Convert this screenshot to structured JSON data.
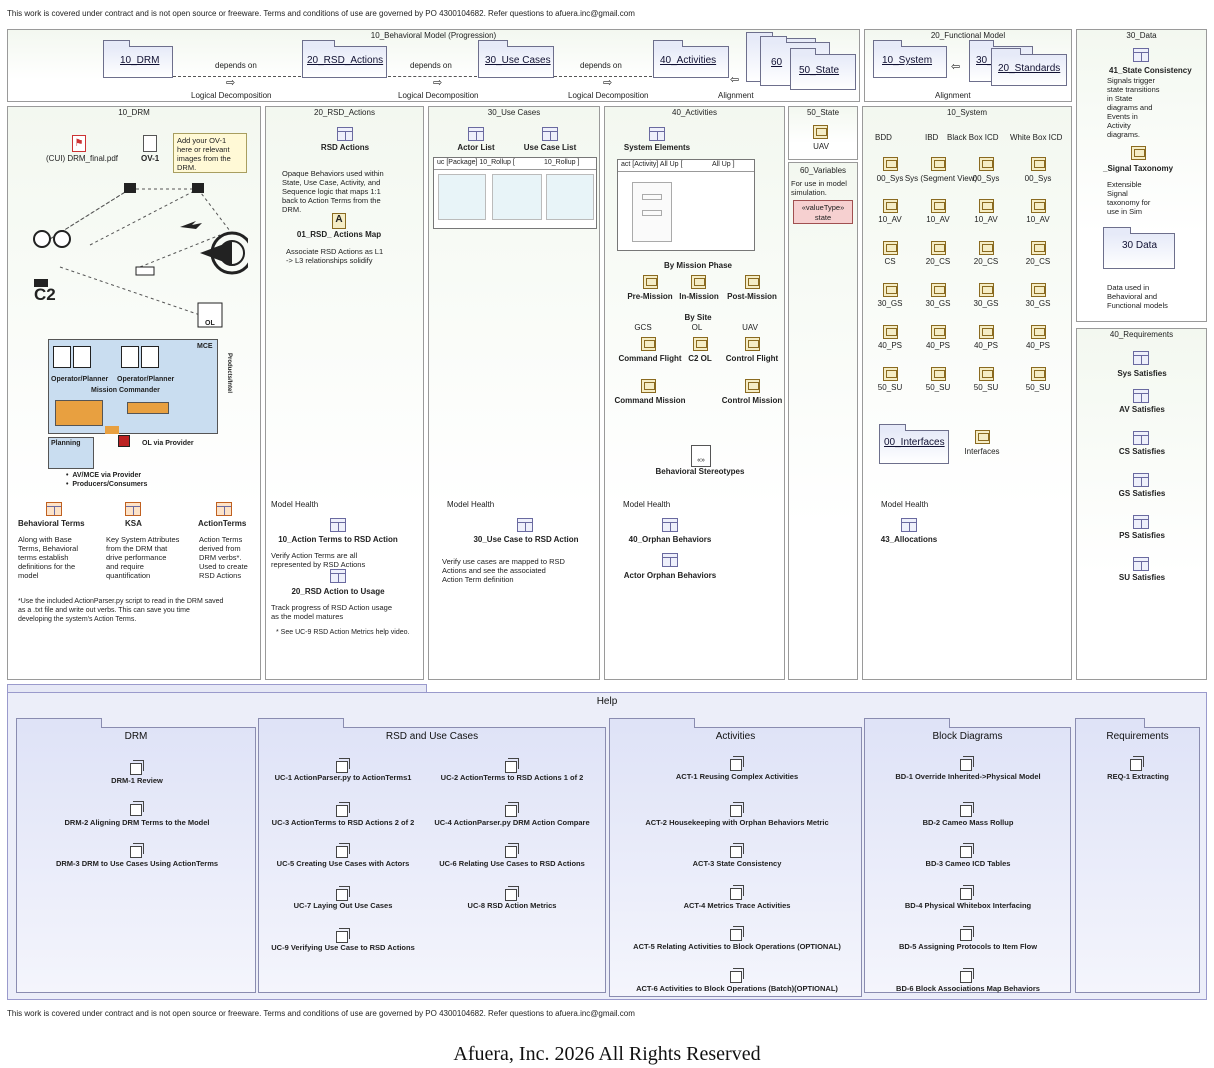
{
  "notice_top": "This work is covered under contract and is not open source or freeware.  Terms and conditions of use are governed by PO 4300104682.  Refer questions to afuera.inc@gmail.com",
  "notice_bottom": "This work is covered under contract and is not open source or freeware.  Terms and conditions of use are governed by PO 4300104682.  Refer questions to afuera.inc@gmail.com",
  "footer": "Afuera, Inc. 2026 All Rights Reserved",
  "behavioral": {
    "title": "10_Behavioral Model (Progression)",
    "packages": [
      "10_DRM",
      "20_RSD_Actions",
      "30_Use Cases",
      "40_Activities",
      "60",
      "50_State"
    ],
    "depends": [
      "depends on",
      "depends on",
      "depends on"
    ],
    "decomp": [
      "Logical Decomposition",
      "Logical Decomposition",
      "Logical Decomposition"
    ],
    "alignment": "Alignment"
  },
  "functional": {
    "title": "20_Functional Model",
    "packages": [
      "10_System",
      "30_F",
      "20_Standards"
    ],
    "alignment": "Alignment"
  },
  "data_panel": {
    "title": "30_Data",
    "state_consistency": "41_State Consistency",
    "state_desc": [
      "Signals trigger",
      "state transitions",
      "in State",
      "diagrams and",
      "Events in",
      "Activity",
      "diagrams."
    ],
    "signal_taxonomy": "_Signal Taxonomy",
    "signal_desc": [
      "Extensible",
      "Signal",
      "taxonomy for",
      "use in Sim"
    ],
    "pkg": "30 Data",
    "pkg_desc": [
      "Data used in",
      "Behavioral and",
      "Functional models"
    ]
  },
  "requirements": {
    "title": "40_Requirements",
    "items": [
      "Sys Satisfies",
      "AV Satisfies",
      "CS Satisfies",
      "GS Satisfies",
      "PS Satisfies",
      "SU Satisfies"
    ]
  },
  "drm": {
    "title": "10_DRM",
    "pdf": "(CUI) DRM_final.pdf",
    "ov1": "OV-1",
    "note": [
      "Add your OV-1",
      "here or relevant",
      "images from the",
      "DRM."
    ],
    "c2": "C2",
    "ol": "OL",
    "mce": "MCE",
    "op1": "Operator/Planner",
    "op2": "Operator/Planner",
    "mission_commander": "Mission Commander",
    "products": "Products/Intel",
    "planning": "Planning",
    "ol_provider": "OL via Provider",
    "bullets": [
      "AV/MCE via Provider",
      "Producers/Consumers"
    ],
    "terms": [
      {
        "label": "Behavioral Terms",
        "desc": [
          "Along with Base",
          "Terms, Behavioral",
          "terms establish",
          "definitions for the",
          "model"
        ]
      },
      {
        "label": "KSA",
        "desc": [
          "Key System Attributes",
          "from the DRM that",
          "drive performance",
          "and require",
          "quantification"
        ]
      },
      {
        "label": "ActionTerms",
        "desc": [
          "Action Terms",
          "derived from",
          "DRM verbs*.",
          "Used to create",
          "RSD Actions"
        ]
      }
    ],
    "footnote": [
      "*Use the included ActionParser.py script to read in the DRM saved",
      "as a .txt file and write out verbs.   This can save you time",
      "developing the system's Action Terms."
    ]
  },
  "rsd": {
    "title": "20_RSD_Actions",
    "rsd_actions": "RSD Actions",
    "desc": [
      "Opaque Behaviors used within",
      "State, Use Case, Activity, and",
      "Sequence logic that maps 1:1",
      "back to Action Terms from the",
      "DRM."
    ],
    "actions_map": "01_RSD_ Actions Map",
    "map_desc": [
      "Associate RSD Actions as L1",
      "-> L3 relationships solidify"
    ],
    "model_health": "Model Health",
    "mh1": "10_Action Terms to RSD Action",
    "mh1_desc": [
      "Verify Action Terms are all",
      "represented by RSD Actions"
    ],
    "mh2": "20_RSD Action to Usage",
    "mh2_desc": [
      "Track progress of RSD Action usage",
      "as the model matures"
    ],
    "see": "* See UC-9 RSD Action Metrics help video."
  },
  "uc": {
    "title": "30_Use Cases",
    "actor_list": "Actor List",
    "uc_list": "Use Case List",
    "diagram_label": "uc [Package] 10_Rollup [",
    "diagram_tag": "10_Rollup ]",
    "model_health": "Model Health",
    "mh": "30_Use Case to RSD Action",
    "mh_desc": [
      "Verify use cases are mapped to RSD",
      "Actions and see the associated",
      "Action Term definition"
    ]
  },
  "act": {
    "title": "40_Activities",
    "system_elements": "System Elements",
    "diagram_label": "act [Activity] All Up [",
    "diagram_tag": "All Up ]",
    "by_phase": "By Mission Phase",
    "phases": [
      "Pre-Mission",
      "In-Mission",
      "Post-Mission"
    ],
    "by_site": "By Site",
    "sites": [
      "GCS",
      "OL",
      "UAV"
    ],
    "site_items": [
      "Command Flight",
      "C2 OL",
      "Control Flight"
    ],
    "missions": [
      "Command Mission",
      "Control Mission"
    ],
    "stereo": "Behavioral Stereotypes",
    "model_health": "Model Health",
    "orphan1": "40_Orphan Behaviors",
    "orphan2": "Actor Orphan Behaviors"
  },
  "state": {
    "title": "50_State",
    "uav": "UAV",
    "vars_title": "60_Variables",
    "vars_desc": [
      "For use in model",
      "simulation."
    ],
    "valuetype": "«valueType»",
    "valuetype_name": "state"
  },
  "system": {
    "title": "10_System",
    "headers": [
      "BDD",
      "IBD",
      "Black Box ICD",
      "White Box ICD"
    ],
    "row1_labels": [
      "00_Sys",
      "Sys (Segment View)",
      "00_Sys",
      "00_Sys"
    ],
    "rows": [
      [
        "10_AV",
        "10_AV",
        "10_AV",
        "10_AV"
      ],
      [
        "CS",
        "20_CS",
        "20_CS",
        "20_CS"
      ],
      [
        "30_GS",
        "30_GS",
        "30_GS",
        "30_GS"
      ],
      [
        "40_PS",
        "40_PS",
        "40_PS",
        "40_PS"
      ],
      [
        "50_SU",
        "50_SU",
        "50_SU",
        "50_SU"
      ]
    ],
    "interfaces_pkg": "00_Interfaces",
    "interfaces": "Interfaces",
    "model_health": "Model Health",
    "allocations": "43_Allocations"
  },
  "help": {
    "title": "Help",
    "sections": [
      {
        "title": "DRM",
        "items": [
          "DRM-1 Review",
          "DRM-2 Aligning DRM Terms to the Model",
          "DRM-3 DRM to Use Cases Using ActionTerms"
        ]
      },
      {
        "title": "RSD and Use Cases",
        "items": [
          "UC-1 ActionParser.py to ActionTerms1",
          "UC-2 ActionTerms to RSD Actions 1 of 2",
          "UC-3 ActionTerms to RSD Actions 2 of 2",
          "UC-4 ActionParser.py DRM Action Compare",
          "UC-5 Creating Use Cases with Actors",
          "UC-6 Relating Use Cases to RSD Actions",
          "UC-7 Laying Out Use Cases",
          "UC-8 RSD Action Metrics",
          "UC-9 Verifying Use Case to RSD Actions"
        ]
      },
      {
        "title": "Activities",
        "items": [
          "ACT-1 Reusing Complex Activities",
          "ACT-2 Housekeeping with Orphan Behaviors Metric",
          "ACT-3 State Consistency",
          "ACT-4 Metrics Trace Activities",
          "ACT-5 Relating Activities to Block Operations (OPTIONAL)",
          "ACT-6 Activities to Block Operations (Batch)(OPTIONAL)"
        ]
      },
      {
        "title": "Block Diagrams",
        "items": [
          "BD-1 Override Inherited->Physical Model",
          "BD-2 Cameo Mass Rollup",
          "BD-3 Cameo ICD Tables",
          "BD-4 Physical Whitebox Interfacing",
          "BD-5 Assigning Protocols to Item Flow",
          "BD-6 Block Associations Map Behaviors"
        ]
      },
      {
        "title": "Requirements",
        "items": [
          "REQ-1 Extracting"
        ]
      }
    ]
  }
}
